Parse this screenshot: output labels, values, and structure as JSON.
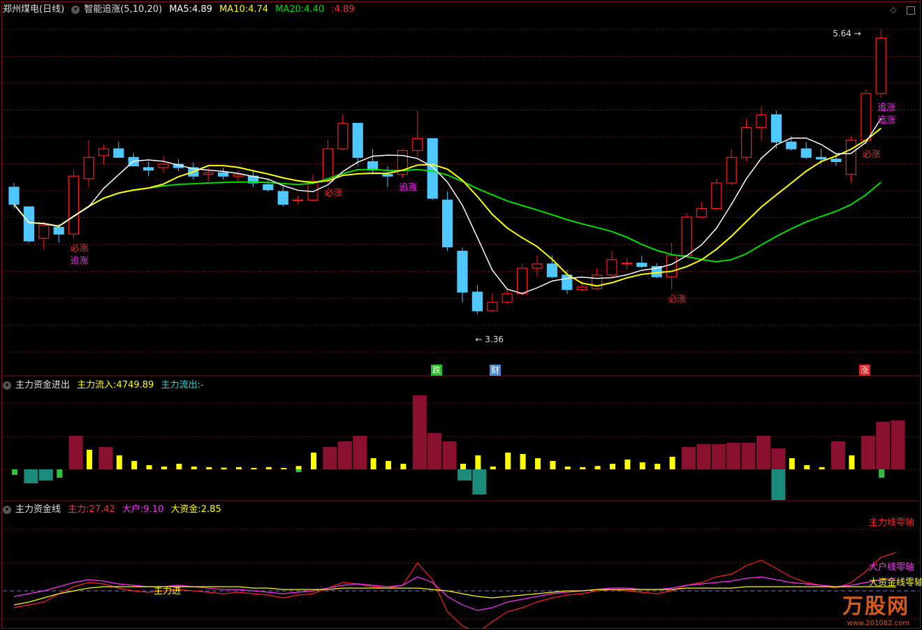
{
  "main": {
    "stock": "郑州煤电",
    "period": "(日线)",
    "indicator": "智能追涨(5,10,20)",
    "ma5_label": "MA5:",
    "ma5": "4.89",
    "ma10_label": "MA10:",
    "ma10": "4.74",
    "ma20_label": "MA20:",
    "ma20": "4.40",
    "last_label": ":",
    "last": "4.89",
    "high_tag": "5.64",
    "low_tag": "3.36",
    "signals": [
      {
        "bar": 4,
        "text": "必涨",
        "color": "#ff2020"
      },
      {
        "bar": 4,
        "text": "追涨",
        "color": "#ff20ff"
      },
      {
        "bar": 21,
        "text": "必涨",
        "color": "#ff2020"
      },
      {
        "bar": 26,
        "text": "追涨",
        "color": "#ff20ff"
      },
      {
        "bar": 44,
        "text": "必涨",
        "color": "#ff2020"
      },
      {
        "bar": 57,
        "text": "必涨",
        "color": "#ff2020"
      },
      {
        "bar": 58,
        "text": "追涨",
        "color": "#ff20ff"
      },
      {
        "bar": 58,
        "text": "追涨",
        "color": "#ff20ff"
      }
    ],
    "markers": [
      {
        "text": "跌",
        "color": "#20c020"
      },
      {
        "text": "财",
        "color": "#4a8ad8"
      },
      {
        "text": "涨",
        "color": "#e02020"
      }
    ]
  },
  "pane2": {
    "title": "主力资金进出",
    "in_label": "主力流入:",
    "in_value": "4749.89",
    "out_label": "主力流出:",
    "out_value": "-"
  },
  "pane3": {
    "title": "主力资金线",
    "a_label": "主力:",
    "a_value": "27.42",
    "b_label": "大户:",
    "b_value": "9.10",
    "c_label": "大资金:",
    "c_value": "2.85",
    "zero_label": "主力进",
    "tag_a": "主力线零轴",
    "tag_b": "大户线零轴",
    "tag_c": "大资金线零轴"
  },
  "watermark": {
    "name": "万股网",
    "url": "www.201082.com"
  },
  "colors": {
    "up": "#ff1a1a",
    "down": "#4ec8ff",
    "ma5": "#ffffff",
    "ma10": "#ffff00",
    "ma20": "#00e000",
    "bg": "#000000",
    "grid": "#7a1010"
  },
  "chart_data": [
    {
      "type": "candlestick",
      "title": "郑州煤电 (日线)",
      "ohlc": [
        [
          4.85,
          4.9,
          4.6,
          4.65
        ],
        [
          4.62,
          4.62,
          4.2,
          4.22
        ],
        [
          4.25,
          4.45,
          4.12,
          4.4
        ],
        [
          4.38,
          4.42,
          4.2,
          4.3
        ],
        [
          4.3,
          5.05,
          4.25,
          4.98
        ],
        [
          4.95,
          5.4,
          4.85,
          5.2
        ],
        [
          5.22,
          5.35,
          5.12,
          5.3
        ],
        [
          5.3,
          5.38,
          5.2,
          5.2
        ],
        [
          5.2,
          5.25,
          5.1,
          5.1
        ],
        [
          5.08,
          5.15,
          4.98,
          5.05
        ],
        [
          5.08,
          5.22,
          5.02,
          5.12
        ],
        [
          5.12,
          5.18,
          5.04,
          5.08
        ],
        [
          5.08,
          5.14,
          4.94,
          4.98
        ],
        [
          5.0,
          5.08,
          4.92,
          5.02
        ],
        [
          5.02,
          5.08,
          4.94,
          4.98
        ],
        [
          4.98,
          5.05,
          4.9,
          5.0
        ],
        [
          4.98,
          5.05,
          4.85,
          4.9
        ],
        [
          4.88,
          4.95,
          4.8,
          4.82
        ],
        [
          4.8,
          4.88,
          4.62,
          4.65
        ],
        [
          4.7,
          4.75,
          4.65,
          4.7
        ],
        [
          4.7,
          5.0,
          4.68,
          4.92
        ],
        [
          4.92,
          5.4,
          4.9,
          5.3
        ],
        [
          5.3,
          5.7,
          5.28,
          5.6
        ],
        [
          5.6,
          5.6,
          5.1,
          5.2
        ],
        [
          5.15,
          5.3,
          5.0,
          5.05
        ],
        [
          5.0,
          5.1,
          4.85,
          4.98
        ],
        [
          5.0,
          5.3,
          4.96,
          5.28
        ],
        [
          5.28,
          5.75,
          5.2,
          5.42
        ],
        [
          5.42,
          5.42,
          4.7,
          4.72
        ],
        [
          4.7,
          4.8,
          4.1,
          4.15
        ],
        [
          4.1,
          4.14,
          3.5,
          3.62
        ],
        [
          3.62,
          3.7,
          3.36,
          3.4
        ],
        [
          3.4,
          3.6,
          3.38,
          3.5
        ],
        [
          3.5,
          3.65,
          3.48,
          3.6
        ],
        [
          3.6,
          3.95,
          3.58,
          3.9
        ],
        [
          3.9,
          4.05,
          3.8,
          3.95
        ],
        [
          3.95,
          4.05,
          3.78,
          3.8
        ],
        [
          3.82,
          3.88,
          3.6,
          3.65
        ],
        [
          3.65,
          3.75,
          3.62,
          3.68
        ],
        [
          3.66,
          3.9,
          3.64,
          3.82
        ],
        [
          3.82,
          4.1,
          3.78,
          4.0
        ],
        [
          3.95,
          4.02,
          3.88,
          3.96
        ],
        [
          3.96,
          4.05,
          3.9,
          3.92
        ],
        [
          3.92,
          3.96,
          3.78,
          3.8
        ],
        [
          3.8,
          4.2,
          3.65,
          4.05
        ],
        [
          4.05,
          4.55,
          4.02,
          4.5
        ],
        [
          4.5,
          4.68,
          4.48,
          4.6
        ],
        [
          4.6,
          4.95,
          4.58,
          4.9
        ],
        [
          4.9,
          5.3,
          4.88,
          5.2
        ],
        [
          5.2,
          5.65,
          5.15,
          5.55
        ],
        [
          5.55,
          5.8,
          5.4,
          5.7
        ],
        [
          5.7,
          5.75,
          5.3,
          5.38
        ],
        [
          5.38,
          5.45,
          5.28,
          5.3
        ],
        [
          5.3,
          5.38,
          5.18,
          5.2
        ],
        [
          5.2,
          5.3,
          5.12,
          5.18
        ],
        [
          5.18,
          5.25,
          5.1,
          5.15
        ],
        [
          5.0,
          5.45,
          4.9,
          5.4
        ],
        [
          5.4,
          6.0,
          5.35,
          5.95
        ],
        [
          5.95,
          6.7,
          5.9,
          6.6
        ]
      ],
      "ma": {
        "MA5": 4.89,
        "MA10": 4.74,
        "MA20": 4.4
      },
      "annotations": [
        "5.64",
        "3.36"
      ],
      "grid": true
    },
    {
      "type": "bar",
      "title": "主力资金进出",
      "series": [
        {
          "name": "主力流入",
          "values": [
            0,
            0,
            0,
            0,
            1200,
            700,
            800,
            500,
            300,
            150,
            100,
            200,
            100,
            80,
            60,
            80,
            50,
            80,
            50,
            120,
            600,
            800,
            1000,
            1200,
            400,
            300,
            200,
            2650,
            1300,
            1000,
            200,
            500,
            100,
            600,
            550,
            400,
            300,
            100,
            80,
            120,
            200,
            350,
            250,
            200,
            450,
            800,
            900,
            900,
            950,
            950,
            1200,
            750,
            400,
            150,
            80,
            1000,
            500,
            1200,
            1700,
            1750
          ]
        },
        {
          "name": "主力流出",
          "values": [
            200,
            500,
            400,
            300,
            0,
            0,
            0,
            0,
            0,
            0,
            0,
            0,
            0,
            0,
            0,
            0,
            0,
            0,
            0,
            100,
            0,
            0,
            0,
            0,
            0,
            0,
            0,
            0,
            0,
            0,
            400,
            900,
            0,
            0,
            0,
            0,
            0,
            0,
            0,
            0,
            0,
            0,
            0,
            0,
            0,
            0,
            0,
            0,
            0,
            0,
            0,
            1100,
            0,
            0,
            0,
            0,
            0,
            0,
            300,
            0
          ]
        }
      ],
      "grid": true
    },
    {
      "type": "line",
      "title": "主力资金线",
      "series": [
        {
          "name": "主力",
          "values": [
            -12,
            -10,
            -8,
            -2,
            3,
            6,
            5,
            2,
            0,
            -1,
            0,
            1,
            0,
            -1,
            -2,
            -1,
            -2,
            -3,
            -5,
            -3,
            -2,
            2,
            6,
            5,
            3,
            2,
            4,
            20,
            8,
            -15,
            -25,
            -30,
            -22,
            -15,
            -12,
            -8,
            -5,
            -3,
            -2,
            0,
            1,
            0,
            -1,
            -2,
            0,
            4,
            6,
            10,
            12,
            18,
            22,
            16,
            10,
            6,
            4,
            2,
            6,
            14,
            24,
            27.42
          ]
        },
        {
          "name": "大户",
          "values": [
            -4,
            -2,
            0,
            3,
            6,
            8,
            7,
            5,
            4,
            3,
            3,
            4,
            3,
            2,
            1,
            1,
            0,
            -1,
            -2,
            -1,
            0,
            2,
            4,
            5,
            4,
            3,
            4,
            10,
            6,
            -4,
            -10,
            -14,
            -12,
            -8,
            -6,
            -4,
            -2,
            -1,
            0,
            1,
            2,
            2,
            1,
            1,
            2,
            4,
            5,
            6,
            7,
            9,
            10,
            8,
            6,
            5,
            4,
            3,
            4,
            6,
            8,
            9.1
          ]
        },
        {
          "name": "大资金",
          "values": [
            -10,
            -8,
            -5,
            -2,
            0,
            2,
            3,
            3,
            3,
            3,
            3,
            3,
            3,
            3,
            3,
            3,
            2,
            2,
            1,
            1,
            1,
            1,
            2,
            2,
            2,
            2,
            2,
            2,
            1,
            0,
            -2,
            -4,
            -5,
            -4,
            -3,
            -2,
            -1,
            0,
            0,
            1,
            1,
            1,
            1,
            1,
            1,
            2,
            2,
            2,
            2,
            3,
            3,
            3,
            3,
            3,
            3,
            3,
            3,
            3,
            3,
            2.85
          ]
        }
      ],
      "grid": true
    }
  ]
}
